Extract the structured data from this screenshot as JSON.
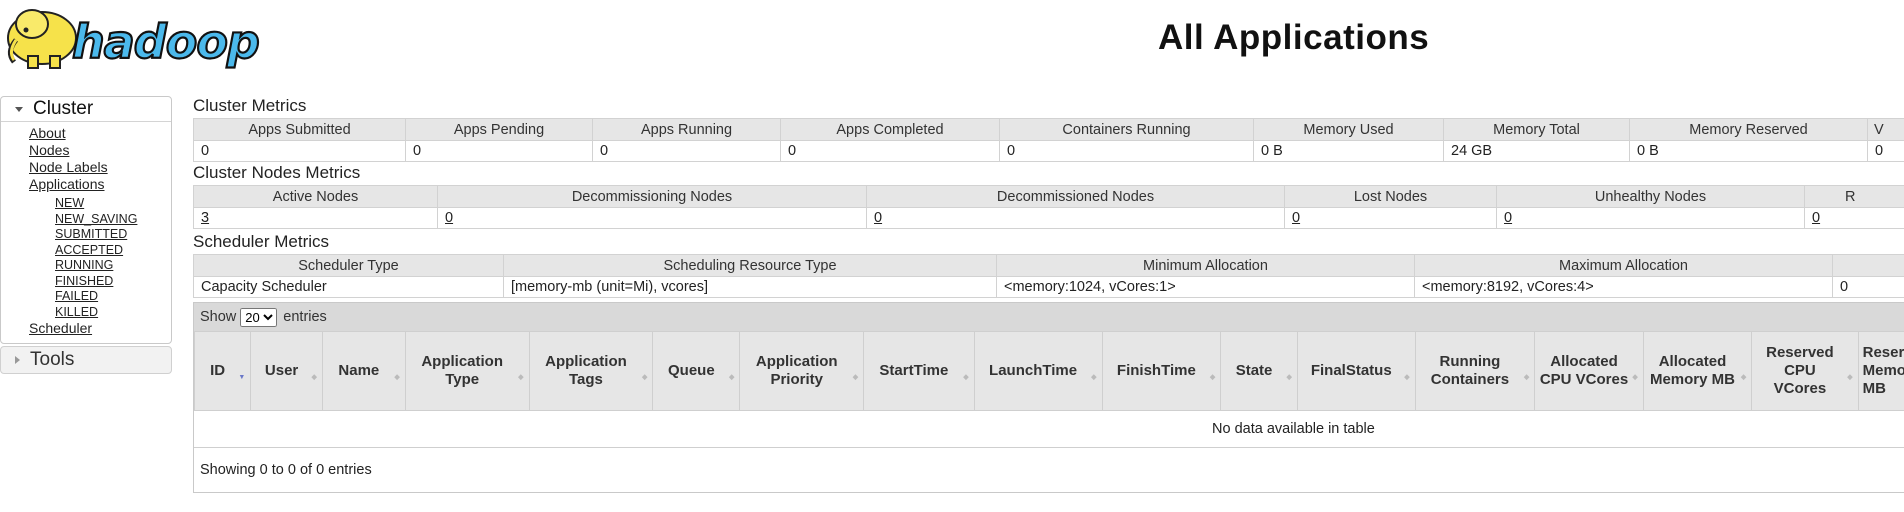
{
  "page_title": "All Applications",
  "logo_text": "hadoop",
  "sidebar": {
    "cluster_label": "Cluster",
    "links": [
      "About",
      "Nodes",
      "Node Labels",
      "Applications"
    ],
    "app_states": [
      "NEW",
      "NEW_SAVING",
      "SUBMITTED",
      "ACCEPTED",
      "RUNNING",
      "FINISHED",
      "FAILED",
      "KILLED"
    ],
    "scheduler_label": "Scheduler",
    "tools_label": "Tools"
  },
  "cluster_metrics": {
    "title": "Cluster Metrics",
    "headers": [
      "Apps Submitted",
      "Apps Pending",
      "Apps Running",
      "Apps Completed",
      "Containers Running",
      "Memory Used",
      "Memory Total",
      "Memory Reserved",
      "V"
    ],
    "values": [
      "0",
      "0",
      "0",
      "0",
      "0",
      "0 B",
      "24 GB",
      "0 B",
      "0"
    ]
  },
  "cluster_nodes_metrics": {
    "title": "Cluster Nodes Metrics",
    "headers": [
      "Active Nodes",
      "Decommissioning Nodes",
      "Decommissioned Nodes",
      "Lost Nodes",
      "Unhealthy Nodes",
      "R"
    ],
    "values": [
      "3",
      "0",
      "0",
      "0",
      "0",
      "0"
    ]
  },
  "scheduler_metrics": {
    "title": "Scheduler Metrics",
    "headers": [
      "Scheduler Type",
      "Scheduling Resource Type",
      "Minimum Allocation",
      "Maximum Allocation",
      ""
    ],
    "values": [
      "Capacity Scheduler",
      "[memory-mb (unit=Mi), vcores]",
      "<memory:1024, vCores:1>",
      "<memory:8192, vCores:4>",
      "0"
    ]
  },
  "apps_table": {
    "show_label": "Show",
    "page_size": "20",
    "entries_label": "entries",
    "columns": [
      "ID",
      "User",
      "Name",
      "Application Type",
      "Application Tags",
      "Queue",
      "Application Priority",
      "StartTime",
      "LaunchTime",
      "FinishTime",
      "State",
      "FinalStatus",
      "Running Containers",
      "Allocated CPU VCores",
      "Allocated Memory MB",
      "Reserved CPU VCores",
      "Reserved Memory MB"
    ],
    "empty_message": "No data available in table",
    "info": "Showing 0 to 0 of 0 entries"
  }
}
